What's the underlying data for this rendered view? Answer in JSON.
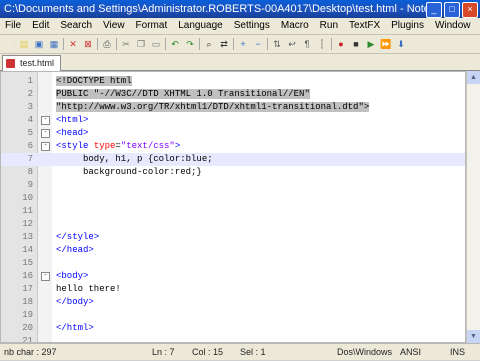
{
  "window": {
    "title": "C:\\Documents and Settings\\Administrator.ROBERTS-00A4017\\Desktop\\test.html - Note...",
    "buttons": [
      "_",
      "□",
      "×"
    ]
  },
  "menu": [
    "File",
    "Edit",
    "Search",
    "View",
    "Format",
    "Language",
    "Settings",
    "Macro",
    "Run",
    "TextFX",
    "Plugins",
    "Window",
    "?"
  ],
  "toolbar_icons": [
    "new-file-icon",
    "open-file-icon",
    "save-icon",
    "save-all-icon",
    "close-icon",
    "close-all-icon",
    "print-icon",
    "cut-icon",
    "copy-icon",
    "paste-icon",
    "undo-icon",
    "redo-icon",
    "find-icon",
    "replace-icon",
    "zoom-in-icon",
    "zoom-out-icon",
    "sync-scroll-icon",
    "word-wrap-icon",
    "show-all-icon",
    "indent-guide-icon",
    "record-macro-icon",
    "stop-macro-icon",
    "play-macro-icon",
    "run-macro-icon",
    "save-macro-icon"
  ],
  "tab": {
    "label": "test.html"
  },
  "editor": {
    "lines": [
      {
        "n": "1",
        "fold": "",
        "text": "<!DOCTYPE html"
      },
      {
        "n": "2",
        "fold": "",
        "text": "PUBLIC \"-//W3C//DTD XHTML 1.0 Transitional//EN\""
      },
      {
        "n": "3",
        "fold": "",
        "text": "\"http://www.w3.org/TR/xhtml1/DTD/xhtml1-transitional.dtd\">"
      },
      {
        "n": "4",
        "fold": "-",
        "text": "<html>"
      },
      {
        "n": "5",
        "fold": "-",
        "text": "<head>"
      },
      {
        "n": "6",
        "fold": "-",
        "text": "<style type=\"text/css\">"
      },
      {
        "n": "7",
        "fold": "",
        "text": "     body, h1, p {color:blue;"
      },
      {
        "n": "8",
        "fold": "",
        "text": "     background-color:red;}"
      },
      {
        "n": "9",
        "fold": "",
        "text": ""
      },
      {
        "n": "10",
        "fold": "",
        "text": ""
      },
      {
        "n": "11",
        "fold": "",
        "text": ""
      },
      {
        "n": "12",
        "fold": "",
        "text": ""
      },
      {
        "n": "13",
        "fold": "",
        "text": "</style>"
      },
      {
        "n": "14",
        "fold": "",
        "text": "</head>"
      },
      {
        "n": "15",
        "fold": "",
        "text": ""
      },
      {
        "n": "16",
        "fold": "-",
        "text": "<body>"
      },
      {
        "n": "17",
        "fold": "",
        "text": "hello there!"
      },
      {
        "n": "18",
        "fold": "",
        "text": "</body>"
      },
      {
        "n": "19",
        "fold": "",
        "text": ""
      },
      {
        "n": "20",
        "fold": "",
        "text": "</html>"
      },
      {
        "n": "21",
        "fold": "",
        "text": ""
      }
    ]
  },
  "status": {
    "length": "nb char : 297",
    "ln": "Ln : 7",
    "col": "Col : 15",
    "sel": "Sel : 1",
    "eol": "Dos\\Windows",
    "encoding": "ANSI",
    "mode": "INS"
  }
}
